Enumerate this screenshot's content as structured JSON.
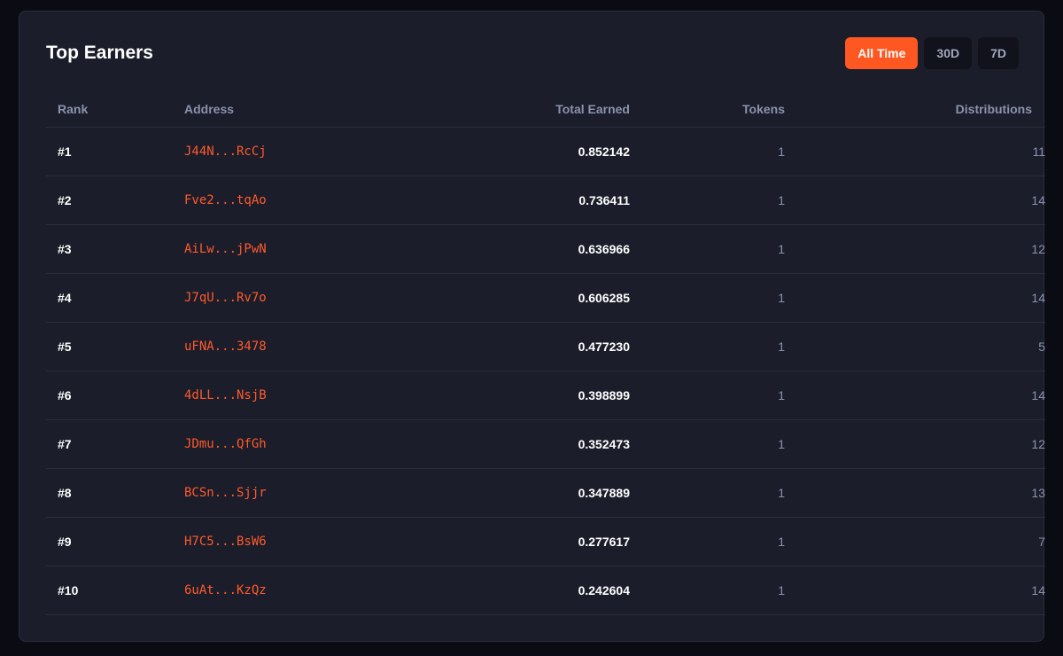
{
  "title": "Top Earners",
  "colors": {
    "accent": "#ff5722",
    "address": "#ff5a2b",
    "card_bg": "#1b1d2a",
    "page_bg": "#0b0c13"
  },
  "filters": [
    {
      "label": "All Time",
      "active": true
    },
    {
      "label": "30D",
      "active": false
    },
    {
      "label": "7D",
      "active": false
    }
  ],
  "table": {
    "columns": [
      "Rank",
      "Address",
      "Total Earned",
      "Tokens",
      "Distributions"
    ],
    "rows": [
      {
        "rank": "#1",
        "address": "J44N...RcCj",
        "total_earned": "0.852142",
        "tokens": "1",
        "distributions": "11"
      },
      {
        "rank": "#2",
        "address": "Fve2...tqAo",
        "total_earned": "0.736411",
        "tokens": "1",
        "distributions": "14"
      },
      {
        "rank": "#3",
        "address": "AiLw...jPwN",
        "total_earned": "0.636966",
        "tokens": "1",
        "distributions": "12"
      },
      {
        "rank": "#4",
        "address": "J7qU...Rv7o",
        "total_earned": "0.606285",
        "tokens": "1",
        "distributions": "14"
      },
      {
        "rank": "#5",
        "address": "uFNA...3478",
        "total_earned": "0.477230",
        "tokens": "1",
        "distributions": "5"
      },
      {
        "rank": "#6",
        "address": "4dLL...NsjB",
        "total_earned": "0.398899",
        "tokens": "1",
        "distributions": "14"
      },
      {
        "rank": "#7",
        "address": "JDmu...QfGh",
        "total_earned": "0.352473",
        "tokens": "1",
        "distributions": "12"
      },
      {
        "rank": "#8",
        "address": "BCSn...Sjjr",
        "total_earned": "0.347889",
        "tokens": "1",
        "distributions": "13"
      },
      {
        "rank": "#9",
        "address": "H7C5...BsW6",
        "total_earned": "0.277617",
        "tokens": "1",
        "distributions": "7"
      },
      {
        "rank": "#10",
        "address": "6uAt...KzQz",
        "total_earned": "0.242604",
        "tokens": "1",
        "distributions": "14"
      }
    ]
  }
}
